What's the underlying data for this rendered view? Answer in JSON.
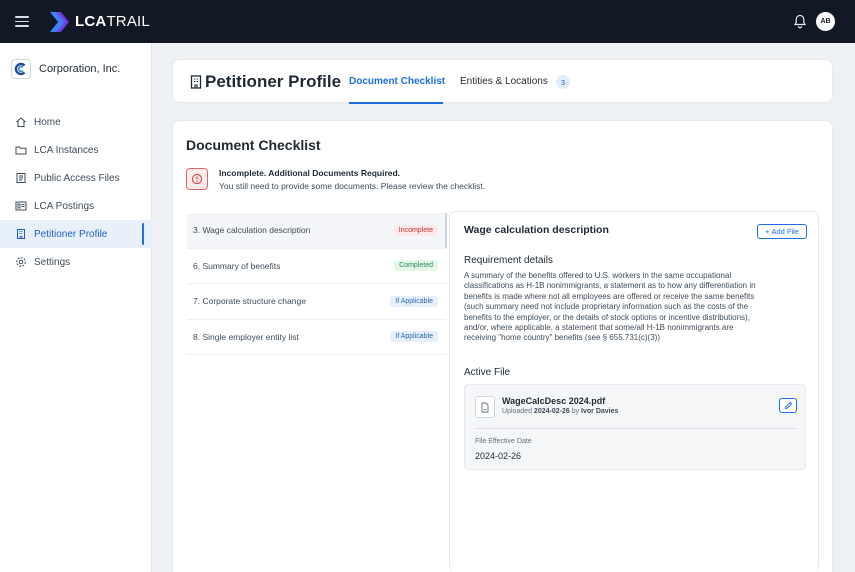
{
  "app": {
    "logo_bold": "LCA",
    "logo_thin": "TRAIL",
    "avatar_initials": "AB",
    "brand_color": "#1f6fe0"
  },
  "sidebar": {
    "org_name": "Corporation, Inc.",
    "items": [
      {
        "label": "Home",
        "icon": "home-icon",
        "active": false
      },
      {
        "label": "LCA Instances",
        "icon": "folder-icon",
        "active": false
      },
      {
        "label": "Public Access Files",
        "icon": "document-icon",
        "active": false
      },
      {
        "label": "LCA Postings",
        "icon": "postings-icon",
        "active": false
      },
      {
        "label": "Petitioner Profile",
        "icon": "building-icon",
        "active": true
      },
      {
        "label": "Settings",
        "icon": "gear-icon",
        "active": false
      }
    ]
  },
  "header": {
    "title": "Petitioner Profile",
    "tabs": [
      {
        "label": "Document Checklist",
        "active": true
      },
      {
        "label": "Entities & Locations",
        "count": "3",
        "active": false
      }
    ]
  },
  "main": {
    "section_title": "Document Checklist",
    "alert": {
      "title": "Incomplete. Additional Documents Required.",
      "body": "You still need to provide some documents. Please review the checklist."
    },
    "checklist": [
      {
        "label": "3. Wage calculation description",
        "status": "Incomplete",
        "selected": true
      },
      {
        "label": "6. Summary of benefits",
        "status": "Completed",
        "selected": false
      },
      {
        "label": "7. Corporate structure change",
        "status": "If Applicable",
        "selected": false
      },
      {
        "label": "8. Single employer entity list",
        "status": "If Applicable",
        "selected": false
      }
    ],
    "detail": {
      "title": "Wage calculation description",
      "add_file_label": "Add File",
      "requirement_title": "Requirement details",
      "requirement_body": "A summary of the benefits offered to U.S. workers in the same occupational classifications as H-1B nonimmigrants, a statement as to how any differentiation in benefits is made where not all employees are offered or receive the same benefits (such summary need not include proprietary information such as the costs of the benefits to the employer, or the details of stock options or incentive distributions), and/or, where applicable, a statement that some/all H-1B nonimmigrants are receiving \"home country\" benefits (see § 655.731(c)(3))",
      "active_file_title": "Active File",
      "file": {
        "name": "WageCalcDesc 2024.pdf",
        "uploaded_prefix": "Uploaded",
        "uploaded_date": "2024-02-26",
        "by_prefix": "by",
        "uploaded_by": "Ivor Davies",
        "effective_label": "File Effective Date",
        "effective_date": "2024-02-26"
      }
    }
  }
}
